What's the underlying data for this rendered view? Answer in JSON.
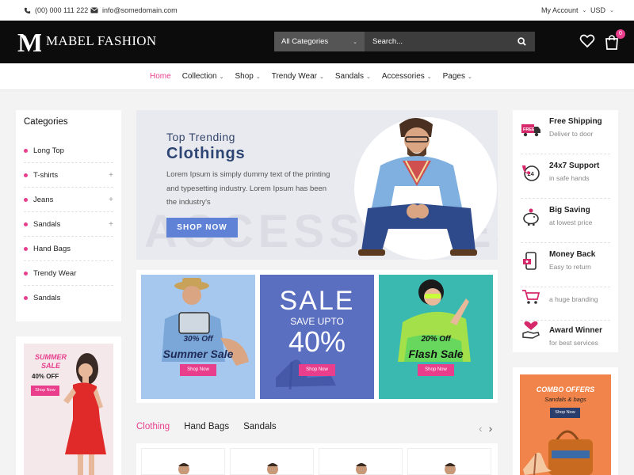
{
  "topbar": {
    "phone": "(00) 000 111 222",
    "email": "info@somedomain.com",
    "account": "My Account",
    "currency": "USD"
  },
  "header": {
    "logo_text": "MABEL FASHION",
    "search_category": "All Categories",
    "search_placeholder": "Search...",
    "cart_count": "0"
  },
  "nav": {
    "items": [
      "Home",
      "Collection",
      "Shop",
      "Trendy Wear",
      "Sandals",
      "Accessories",
      "Pages"
    ]
  },
  "categories": {
    "title": "Categories",
    "items": [
      "Long Top",
      "T-shirts",
      "Jeans",
      "Sandals",
      "Hand Bags",
      "Trendy Wear",
      "Sandals"
    ]
  },
  "promo_left": {
    "title": "SUMMER SALE",
    "offer": "40% OFF",
    "button": "Shop Now"
  },
  "hero": {
    "subtitle": "Top Trending",
    "title": "Clothings",
    "text": "Lorem Ipsum is simply dummy text of the printing and typesetting industry. Lorem Ipsum has been the industry's",
    "button": "SHOP NOW",
    "bg_text": "ACCESSORIES"
  },
  "banners": {
    "b1_off": "30% Off",
    "b1_title": "Summer Sale",
    "b1_button": "Shop Now",
    "b2_sale": "SALE",
    "b2_upto": "SAVE UPTO",
    "b2_percent": "40%",
    "b2_button": "Shop Now",
    "b3_off": "20% Off",
    "b3_title": "Flash Sale",
    "b3_button": "Shop Now"
  },
  "tabs": [
    "Clothing",
    "Hand Bags",
    "Sandals"
  ],
  "services": [
    {
      "title": "Free Shipping",
      "sub": "Deliver to door",
      "icon": "free-shipping-icon"
    },
    {
      "title": "24x7 Support",
      "sub": "in safe hands",
      "icon": "support-icon"
    },
    {
      "title": "Big Saving",
      "sub": "at lowest price",
      "icon": "piggy-bank-icon"
    },
    {
      "title": "Money Back",
      "sub": "Easy to return",
      "icon": "money-back-icon"
    },
    {
      "title": "",
      "sub": "a huge branding",
      "icon": "cart-icon"
    },
    {
      "title": "Award Winner",
      "sub": "for best services",
      "icon": "award-icon"
    }
  ],
  "promo_right": {
    "title": "COMBO OFFERS",
    "sub": "Sandals & bags",
    "button": "Shop Now"
  },
  "colors": {
    "accent": "#e83e8c",
    "header_bg": "#0c0c0c",
    "hero_button": "#5f82d6"
  }
}
